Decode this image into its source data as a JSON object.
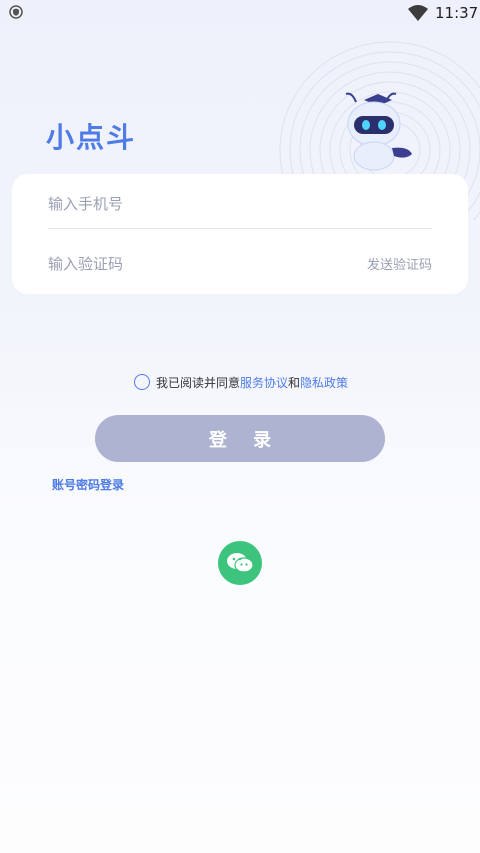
{
  "status_bar": {
    "time": "11:37"
  },
  "app": {
    "title": "小点斗"
  },
  "form": {
    "phone_placeholder": "输入手机号",
    "code_placeholder": "输入验证码",
    "send_code_label": "发送验证码"
  },
  "agreement": {
    "prefix": "我已阅读并同意",
    "terms_link": "服务协议",
    "conjunction": "和",
    "privacy_link": "隐私政策"
  },
  "login_button": "登 录",
  "password_login": "账号密码登录",
  "colors": {
    "accent": "#4e7be6",
    "button": "#aeb3d2",
    "wechat": "#3cc47d"
  },
  "icons": [
    "shield-icon",
    "wifi-icon",
    "robot-mascot",
    "wechat-icon"
  ]
}
